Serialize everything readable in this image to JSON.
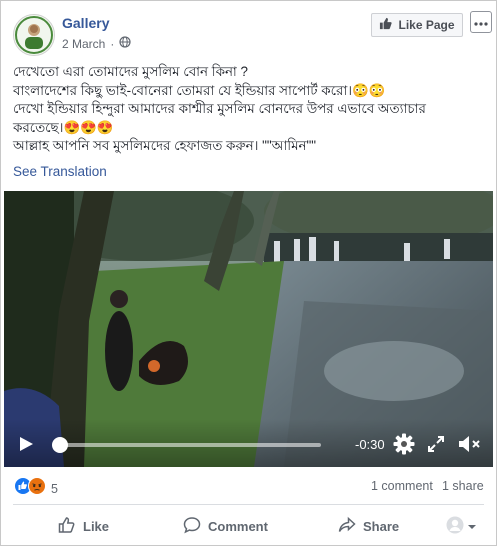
{
  "header": {
    "page_name": "Gallery",
    "date": "2 March",
    "like_page_label": "Like Page"
  },
  "post": {
    "lines": [
      "দেখেতো এরা তোমাদের মুসলিম বোন কিনা ?",
      "বাংলাদেশের কিছু ভাই-বোনেরা তোমরা যে ইন্ডিয়ার সাপোর্ট করো।😳😳",
      "দেখো ইন্ডিয়ার হিন্দুরা আমাদের কাশ্মীর মুসলিম বোনদের উপর এভাবে অত্যাচার",
      "করতেছে।😍😍😍",
      "আল্লাহ আপনি সব মুসলিমদের হেফাজত করুন। \"\"আমিন\"\""
    ],
    "see_translation": "See Translation"
  },
  "video": {
    "time_remaining": "-0:30",
    "progress": 0.0
  },
  "stats": {
    "reaction_count": "5",
    "comments": "1 comment",
    "shares": "1 share"
  },
  "actions": {
    "like": "Like",
    "comment": "Comment",
    "share": "Share"
  },
  "icons": {
    "like_page": "thumbs-up-icon",
    "more": "more-options-icon",
    "privacy": "globe-icon",
    "play": "play-icon",
    "settings": "gear-icon",
    "fullscreen": "fullscreen-icon",
    "volume": "volume-muted-icon"
  },
  "colors": {
    "link": "#365899",
    "like_reaction": "#1877f2",
    "angry_reaction": "#e9710f"
  }
}
